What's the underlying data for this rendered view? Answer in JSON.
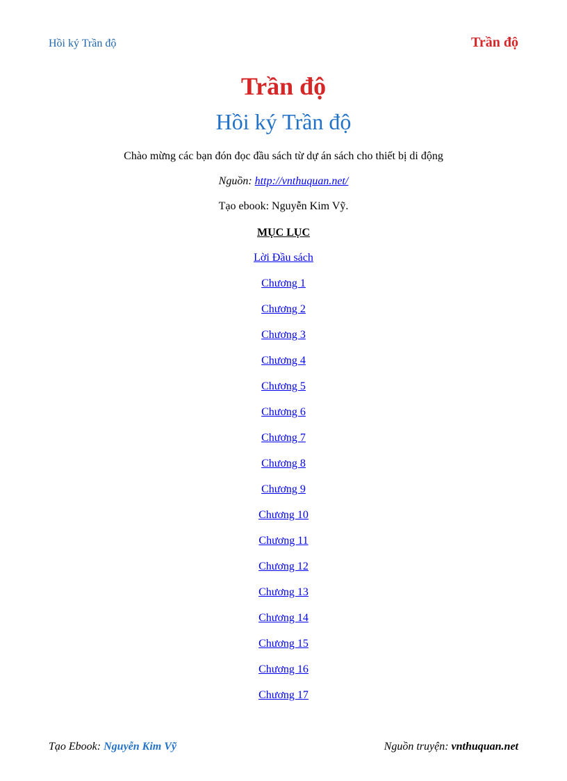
{
  "header": {
    "left": "Hồi ký Trần độ",
    "right": "Trần độ"
  },
  "title": {
    "main": "Trần độ",
    "sub": "Hồi ký Trần độ"
  },
  "intro": "Chào mừng các bạn đón đọc đầu sách từ dự án sách cho thiết bị di động",
  "source": {
    "label": "Nguồn: ",
    "url": "http://vnthuquan.net/"
  },
  "creator": "Tạo ebook: Nguyễn Kim Vỹ.",
  "toc": {
    "heading": "MỤC LỤC",
    "items": [
      "Lời Đầu sách",
      "Chương 1",
      "Chương 2",
      "Chương 3",
      "Chương 4",
      "Chương 5",
      "Chương 6",
      "Chương 7",
      "Chương 8",
      "Chương 9",
      "Chương 10",
      "Chương 11",
      "Chương 12",
      "Chương 13",
      "Chương 14",
      "Chương 15",
      "Chương 16",
      "Chương 17"
    ]
  },
  "footer": {
    "left_label": "Tạo Ebook",
    "left_name": "Nguyễn Kim Vỹ",
    "right_label": "Nguồn truyện",
    "right_site": "vnthuquan.net"
  }
}
